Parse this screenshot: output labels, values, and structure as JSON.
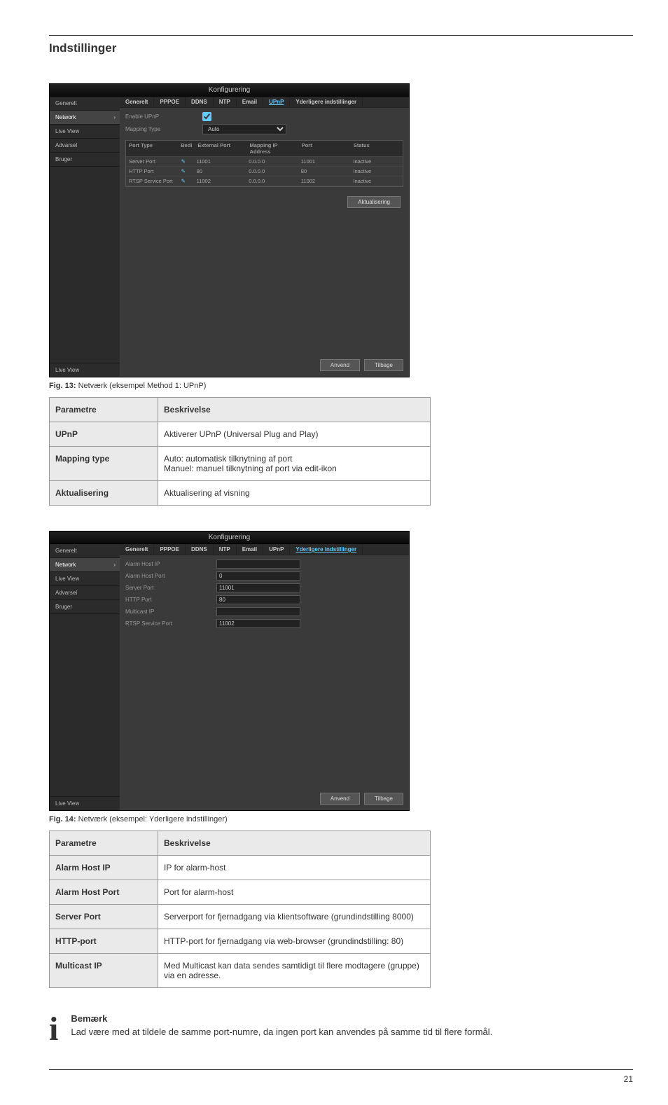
{
  "page": {
    "header_title": "Indstillinger",
    "footer_left": "",
    "footer_right": "21"
  },
  "upnp": {
    "title": "Konfigurering",
    "caption_prefix": "Fig. 13: ",
    "caption": "Netværk (eksempel Method 1: UPnP)",
    "sidebar": {
      "items": [
        "Generelt",
        "Network",
        "Live View",
        "Advarsel",
        "Bruger"
      ],
      "bottom": "Live View",
      "selectedIndex": 1
    },
    "tabs": [
      "Generelt",
      "PPPOE",
      "DDNS",
      "NTP",
      "Email",
      "UPnP",
      "Yderligere indstillinger"
    ],
    "activeTab": 5,
    "enable_label": "Enable UPnP",
    "enable_checked": true,
    "mapping_type_label": "Mapping Type",
    "mapping_type_value": "Auto",
    "table": {
      "headers": [
        "Port Type",
        "Bedi",
        "External Port",
        "Mapping IP Address",
        "Port",
        "Status"
      ],
      "rows": [
        {
          "type": "Server Port",
          "edit": "✎",
          "ext": "11001",
          "ip": "0.0.0.0",
          "port": "11001",
          "status": "Inactive"
        },
        {
          "type": "HTTP Port",
          "edit": "✎",
          "ext": "80",
          "ip": "0.0.0.0",
          "port": "80",
          "status": "Inactive"
        },
        {
          "type": "RTSP Service Port",
          "edit": "✎",
          "ext": "11002",
          "ip": "0.0.0.0",
          "port": "11002",
          "status": "Inactive"
        }
      ]
    },
    "refresh_btn": "Aktualisering",
    "apply_btn": "Anvend",
    "back_btn": "Tilbage",
    "params": {
      "header_param": "Parametre",
      "header_desc": "Beskrivelse",
      "rows": [
        {
          "k": "UPnP",
          "v": "Aktiverer UPnP (Universal Plug and Play)"
        },
        {
          "k": "Mapping type",
          "v": "Auto: automatisk tilknytning af port\nManuel: manuel tilknytning af port via edit-ikon"
        },
        {
          "k": "Aktualisering",
          "v": "Aktualisering af visning"
        }
      ]
    }
  },
  "more": {
    "title": "Konfigurering",
    "caption_prefix": "Fig. 14: ",
    "caption": "Netværk (eksempel: Yderligere indstillinger)",
    "sidebar": {
      "items": [
        "Generelt",
        "Network",
        "Live View",
        "Advarsel",
        "Bruger"
      ],
      "bottom": "Live View",
      "selectedIndex": 1
    },
    "tabs": [
      "Generelt",
      "PPPOE",
      "DDNS",
      "NTP",
      "Email",
      "UPnP",
      "Yderligere indstillinger"
    ],
    "activeTab": 6,
    "fields": [
      {
        "label": "Alarm Host IP",
        "value": ""
      },
      {
        "label": "Alarm Host Port",
        "value": "0"
      },
      {
        "label": "Server Port",
        "value": "11001"
      },
      {
        "label": "HTTP Port",
        "value": "80"
      },
      {
        "label": "Multicast IP",
        "value": ""
      },
      {
        "label": "RTSP Service Port",
        "value": "11002"
      }
    ],
    "apply_btn": "Anvend",
    "back_btn": "Tilbage",
    "params": {
      "header_param": "Parametre",
      "header_desc": "Beskrivelse",
      "rows": [
        {
          "k": "Alarm Host IP",
          "v": "IP for alarm-host"
        },
        {
          "k": "Alarm Host Port",
          "v": "Port for alarm-host"
        },
        {
          "k": "Server Port",
          "v": "Serverport for fjernadgang via klientsoftware (grundindstilling 8000)"
        },
        {
          "k": "HTTP-port",
          "v": "HTTP-port for fjernadgang via web-browser (grundindstilling: 80)"
        },
        {
          "k": "Multicast IP",
          "v": "Med Multicast kan data sendes samtidigt til flere modtagere (gruppe) via en adresse."
        }
      ]
    }
  },
  "note": {
    "heading": "Bemærk",
    "line1": "Lad være med at tildele de samme port-numre, da ingen port kan anvendes ",
    "line2": "på samme tid til flere formål."
  }
}
